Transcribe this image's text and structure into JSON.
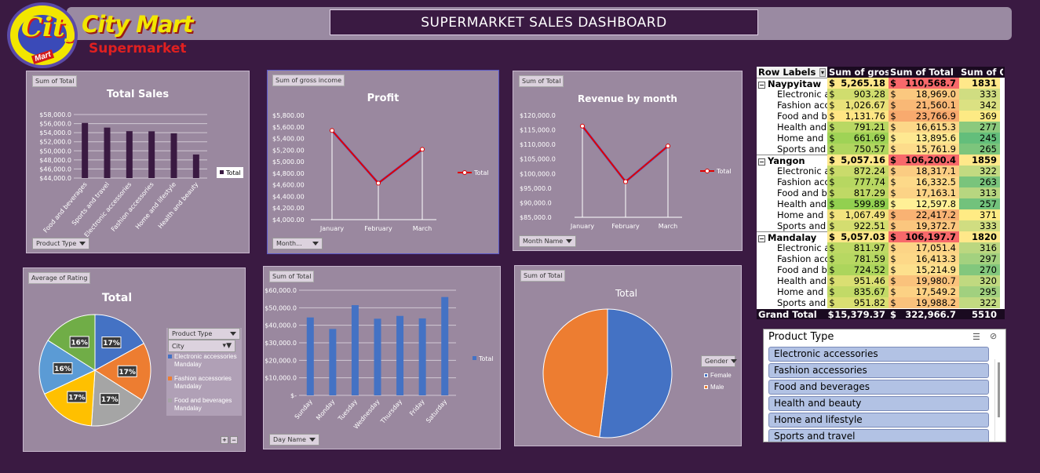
{
  "header": {
    "logo_text": "City",
    "logo_tag": "Mart",
    "brand": "City Mart",
    "brand_sub": "Supermarket",
    "dashboard_title": "SUPERMARKET  SALES  DASHBOARD"
  },
  "colors": {
    "background": "#3a1a42",
    "panel": "#9a889f",
    "bar_dark": "#3a1a42",
    "bar_blue": "#4472c4",
    "line_red": "#e00000",
    "pie_blue": "#4472c4",
    "pie_orange": "#ed7d31",
    "pie_gray": "#a5a5a5",
    "pie_yellow": "#ffc000",
    "pie_lightblue": "#5b9bd5",
    "pie_green": "#70ad47"
  },
  "chart_data": [
    {
      "id": "total_sales",
      "type": "bar",
      "tag": "Sum of Total",
      "title": "Total Sales",
      "filter_label": "Product Type",
      "categories": [
        "Food and beverages",
        "Sports and travel",
        "Electronic accessories",
        "Fashion accessories",
        "Home and lifestyle",
        "Health and beauty"
      ],
      "series": [
        {
          "name": "Total",
          "values": [
            56145,
            55123,
            54338,
            54306,
            53862,
            49193
          ]
        }
      ],
      "y_ticks": [
        "$58,000.0",
        "$56,000.0",
        "$54,000.0",
        "$52,000.0",
        "$50,000.0",
        "$48,000.0",
        "$46,000.0",
        "$44,000.0"
      ],
      "ylim": [
        44000,
        58000
      ],
      "legend": "right",
      "grid": true
    },
    {
      "id": "profit",
      "type": "line",
      "tag": "Sum of gross income",
      "title": "Profit",
      "filter_label": "Month...",
      "categories": [
        "January",
        "February",
        "March"
      ],
      "series": [
        {
          "name": "Total",
          "values": [
            5537.7,
            4629.5,
            5212.2
          ]
        }
      ],
      "y_ticks": [
        "$5,800.00",
        "$5,600.00",
        "$5,400.00",
        "$5,200.00",
        "$5,000.00",
        "$4,800.00",
        "$4,600.00",
        "$4,400.00",
        "$4,200.00",
        "$4,000.00"
      ],
      "ylim": [
        4000,
        5800
      ],
      "legend": "right"
    },
    {
      "id": "revenue_by_month",
      "type": "line",
      "tag": "Sum of Total",
      "title": "Revenue by month",
      "filter_label": "Month Name",
      "categories": [
        "January",
        "February",
        "March"
      ],
      "series": [
        {
          "name": "Total",
          "values": [
            116291.9,
            97219.4,
            109455.5
          ]
        }
      ],
      "y_ticks": [
        "$120,000.0",
        "$115,000.0",
        "$110,000.0",
        "$105,000.0",
        "$100,000.0",
        "$95,000.0",
        "$90,000.0",
        "$85,000.0"
      ],
      "ylim": [
        85000,
        120000
      ],
      "legend": "right"
    },
    {
      "id": "rating_pie",
      "type": "pie",
      "tag": "Average of Rating",
      "title": "Total",
      "slices": [
        {
          "label": "17%",
          "value": 17,
          "color": "#4472c4"
        },
        {
          "label": "17%",
          "value": 17,
          "color": "#ed7d31"
        },
        {
          "label": "17%",
          "value": 17,
          "color": "#a5a5a5"
        },
        {
          "label": "17%",
          "value": 17,
          "color": "#ffc000"
        },
        {
          "label": "16%",
          "value": 16,
          "color": "#5b9bd5"
        },
        {
          "label": "16%",
          "value": 16,
          "color": "#70ad47"
        }
      ],
      "legend_filter_1": "Product Type",
      "legend_filter_2": "City",
      "legend_items": [
        {
          "line1": "Electronic accessories",
          "line2": "Mandalay",
          "color": "#4472c4"
        },
        {
          "line1": "Fashion accessories",
          "line2": "Mandalay",
          "color": "#ed7d31"
        },
        {
          "line1": "Food and beverages",
          "line2": "Mandalay",
          "color": "#a5a5a5"
        }
      ]
    },
    {
      "id": "day_bar",
      "type": "bar",
      "tag": "Sum of Total",
      "filter_label": "Day Name",
      "categories": [
        "Sunday",
        "Monday",
        "Tuesday",
        "Wednesday",
        "Thursday",
        "Friday",
        "Saturday"
      ],
      "series": [
        {
          "name": "Total",
          "values": [
            44458,
            37899,
            51483,
            43731,
            45349,
            43926,
            56121
          ]
        }
      ],
      "y_ticks": [
        "$60,000.0",
        "$50,000.0",
        "$40,000.0",
        "$30,000.0",
        "$20,000.0",
        "$10,000.0",
        "$-"
      ],
      "ylim": [
        0,
        60000
      ],
      "legend": "right",
      "grid": true
    },
    {
      "id": "gender_pie",
      "type": "pie",
      "tag": "Sum of Total",
      "title": "Total",
      "filter_label": "Gender",
      "slices": [
        {
          "label": "Female",
          "value": 167883,
          "color": "#4472c4"
        },
        {
          "label": "Male",
          "value": 155084,
          "color": "#ed7d31"
        }
      ]
    }
  ],
  "pivot": {
    "headers": [
      "Row Labels",
      "Sum of gross income",
      "Sum of Total",
      "Sum of Quantity"
    ],
    "groups": [
      {
        "name": "Naypyitaw",
        "income": "5,265.18",
        "total": "110,568.7",
        "qty": "1831",
        "rows": [
          {
            "label": "Electronic accessories",
            "income": "903.28",
            "total": "18,969.0",
            "qty": "333"
          },
          {
            "label": "Fashion accessories",
            "income": "1,026.67",
            "total": "21,560.1",
            "qty": "342"
          },
          {
            "label": "Food and beverages",
            "income": "1,131.76",
            "total": "23,766.9",
            "qty": "369"
          },
          {
            "label": "Health and beauty",
            "income": "791.21",
            "total": "16,615.3",
            "qty": "277"
          },
          {
            "label": "Home and lifestyle",
            "income": "661.69",
            "total": "13,895.6",
            "qty": "245"
          },
          {
            "label": "Sports and travel",
            "income": "750.57",
            "total": "15,761.9",
            "qty": "265"
          }
        ]
      },
      {
        "name": "Yangon",
        "income": "5,057.16",
        "total": "106,200.4",
        "qty": "1859",
        "rows": [
          {
            "label": "Electronic accessories",
            "income": "872.24",
            "total": "18,317.1",
            "qty": "322"
          },
          {
            "label": "Fashion accessories",
            "income": "777.74",
            "total": "16,332.5",
            "qty": "263"
          },
          {
            "label": "Food and beverages",
            "income": "817.29",
            "total": "17,163.1",
            "qty": "313"
          },
          {
            "label": "Health and beauty",
            "income": "599.89",
            "total": "12,597.8",
            "qty": "257"
          },
          {
            "label": "Home and lifestyle",
            "income": "1,067.49",
            "total": "22,417.2",
            "qty": "371"
          },
          {
            "label": "Sports and travel",
            "income": "922.51",
            "total": "19,372.7",
            "qty": "333"
          }
        ]
      },
      {
        "name": "Mandalay",
        "income": "5,057.03",
        "total": "106,197.7",
        "qty": "1820",
        "rows": [
          {
            "label": "Electronic accessories",
            "income": "811.97",
            "total": "17,051.4",
            "qty": "316"
          },
          {
            "label": "Fashion accessories",
            "income": "781.59",
            "total": "16,413.3",
            "qty": "297"
          },
          {
            "label": "Food and beverages",
            "income": "724.52",
            "total": "15,214.9",
            "qty": "270"
          },
          {
            "label": "Health and beauty",
            "income": "951.46",
            "total": "19,980.7",
            "qty": "320"
          },
          {
            "label": "Home and lifestyle",
            "income": "835.67",
            "total": "17,549.2",
            "qty": "295"
          },
          {
            "label": "Sports and travel",
            "income": "951.82",
            "total": "19,988.2",
            "qty": "322"
          }
        ]
      }
    ],
    "grand": {
      "label": "Grand Total",
      "income": "15,379.37",
      "total": "322,966.7",
      "qty": "5510"
    }
  },
  "slicer": {
    "title": "Product Type",
    "items": [
      "Electronic accessories",
      "Fashion accessories",
      "Food and beverages",
      "Health and beauty",
      "Home and lifestyle",
      "Sports and travel"
    ]
  }
}
